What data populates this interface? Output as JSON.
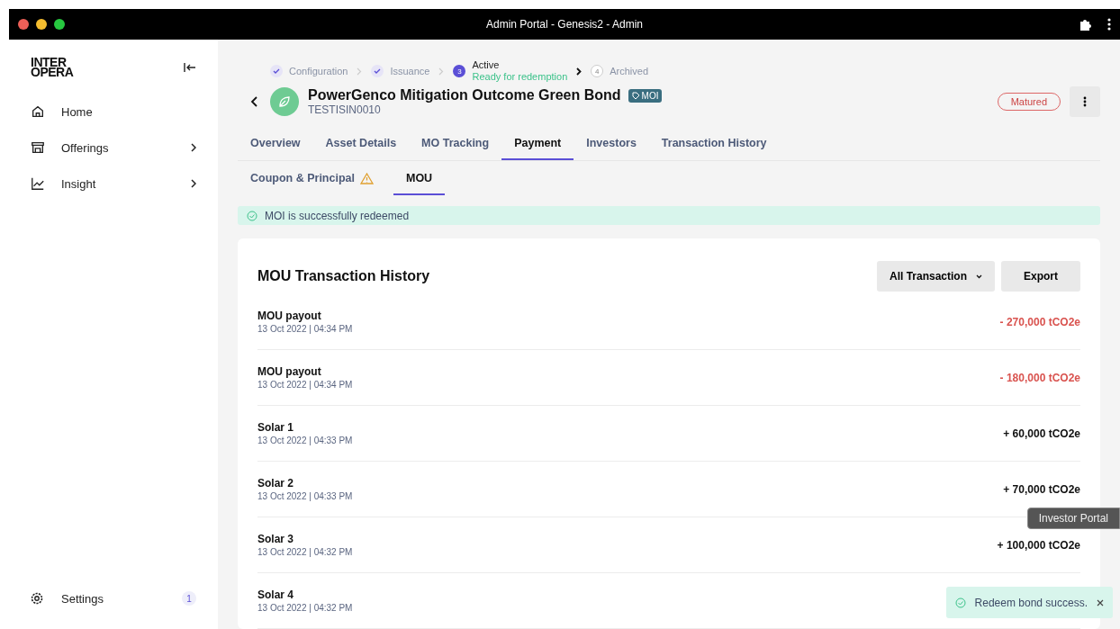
{
  "window": {
    "title": "Admin Portal - Genesis2 - Admin"
  },
  "sidebar": {
    "logo_top": "INTER",
    "logo_bottom": "OPERA",
    "items": [
      {
        "label": "Home",
        "expandable": false,
        "selected": false
      },
      {
        "label": "Offerings",
        "expandable": true,
        "selected": false
      },
      {
        "label": "Insight",
        "expandable": true,
        "selected": false
      }
    ],
    "footer": {
      "label": "Settings",
      "badge": "1"
    }
  },
  "stepper": [
    {
      "label": "Configuration",
      "completed": true,
      "current": false
    },
    {
      "label": "Issuance",
      "completed": true,
      "current": false
    },
    {
      "number": "3",
      "label": "Active",
      "sublabel": "Ready for redemption",
      "completed": false,
      "current": true
    },
    {
      "number": "4",
      "label": "Archived",
      "completed": false,
      "current": false
    }
  ],
  "header": {
    "title": "PowerGenco Mitigation Outcome Green Bond",
    "tag": "MOI",
    "code": "TESTISIN0010",
    "status": "Matured"
  },
  "tabs": [
    {
      "label": "Overview",
      "selected": false
    },
    {
      "label": "Asset Details",
      "selected": false
    },
    {
      "label": "MO Tracking",
      "selected": false
    },
    {
      "label": "Payment",
      "selected": true
    },
    {
      "label": "Investors",
      "selected": false
    },
    {
      "label": "Transaction History",
      "selected": false
    }
  ],
  "subtabs": [
    {
      "label": "Coupon & Principal",
      "warning": true,
      "selected": false
    },
    {
      "label": "MOU",
      "warning": false,
      "selected": true
    }
  ],
  "alert": "MOI is successfully redeemed",
  "card": {
    "title": "MOU Transaction History",
    "filter": "All Transaction",
    "export": "Export",
    "rows": [
      {
        "name": "MOU payout",
        "date": "13 Oct 2022 | 04:34 PM",
        "amount": "- 270,000 tCO2e",
        "kind": "debit"
      },
      {
        "name": "MOU payout",
        "date": "13 Oct 2022 | 04:34 PM",
        "amount": "- 180,000 tCO2e",
        "kind": "debit"
      },
      {
        "name": "Solar 1",
        "date": "13 Oct 2022 | 04:33 PM",
        "amount": "+ 60,000 tCO2e",
        "kind": "credit"
      },
      {
        "name": "Solar 2",
        "date": "13 Oct 2022 | 04:33 PM",
        "amount": "+ 70,000 tCO2e",
        "kind": "credit"
      },
      {
        "name": "Solar 3",
        "date": "13 Oct 2022 | 04:32 PM",
        "amount": "+ 100,000 tCO2e",
        "kind": "credit"
      },
      {
        "name": "Solar 4",
        "date": "13 Oct 2022 | 04:32 PM"
      }
    ]
  },
  "tooltip": "Investor Portal",
  "toast": "Redeem bond success."
}
